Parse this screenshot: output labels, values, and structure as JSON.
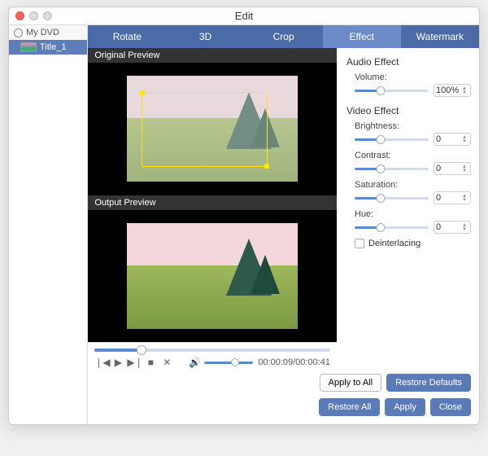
{
  "window": {
    "title": "Edit"
  },
  "sidebar": {
    "root_label": "My DVD",
    "item_label": "Title_1"
  },
  "tabs": {
    "rotate": "Rotate",
    "threed": "3D",
    "crop": "Crop",
    "effect": "Effect",
    "watermark": "Watermark"
  },
  "preview": {
    "original_label": "Original Preview",
    "output_label": "Output Preview"
  },
  "playback": {
    "time": "00:00:09/00:00:41"
  },
  "panel": {
    "audio_title": "Audio Effect",
    "volume_label": "Volume:",
    "volume_value": "100%",
    "video_title": "Video Effect",
    "brightness_label": "Brightness:",
    "brightness_value": "0",
    "contrast_label": "Contrast:",
    "contrast_value": "0",
    "saturation_label": "Saturation:",
    "saturation_value": "0",
    "hue_label": "Hue:",
    "hue_value": "0",
    "deinterlacing": "Deinterlacing"
  },
  "buttons": {
    "apply_all": "Apply to All",
    "restore_defaults": "Restore Defaults",
    "restore_all": "Restore All",
    "apply": "Apply",
    "close": "Close"
  }
}
